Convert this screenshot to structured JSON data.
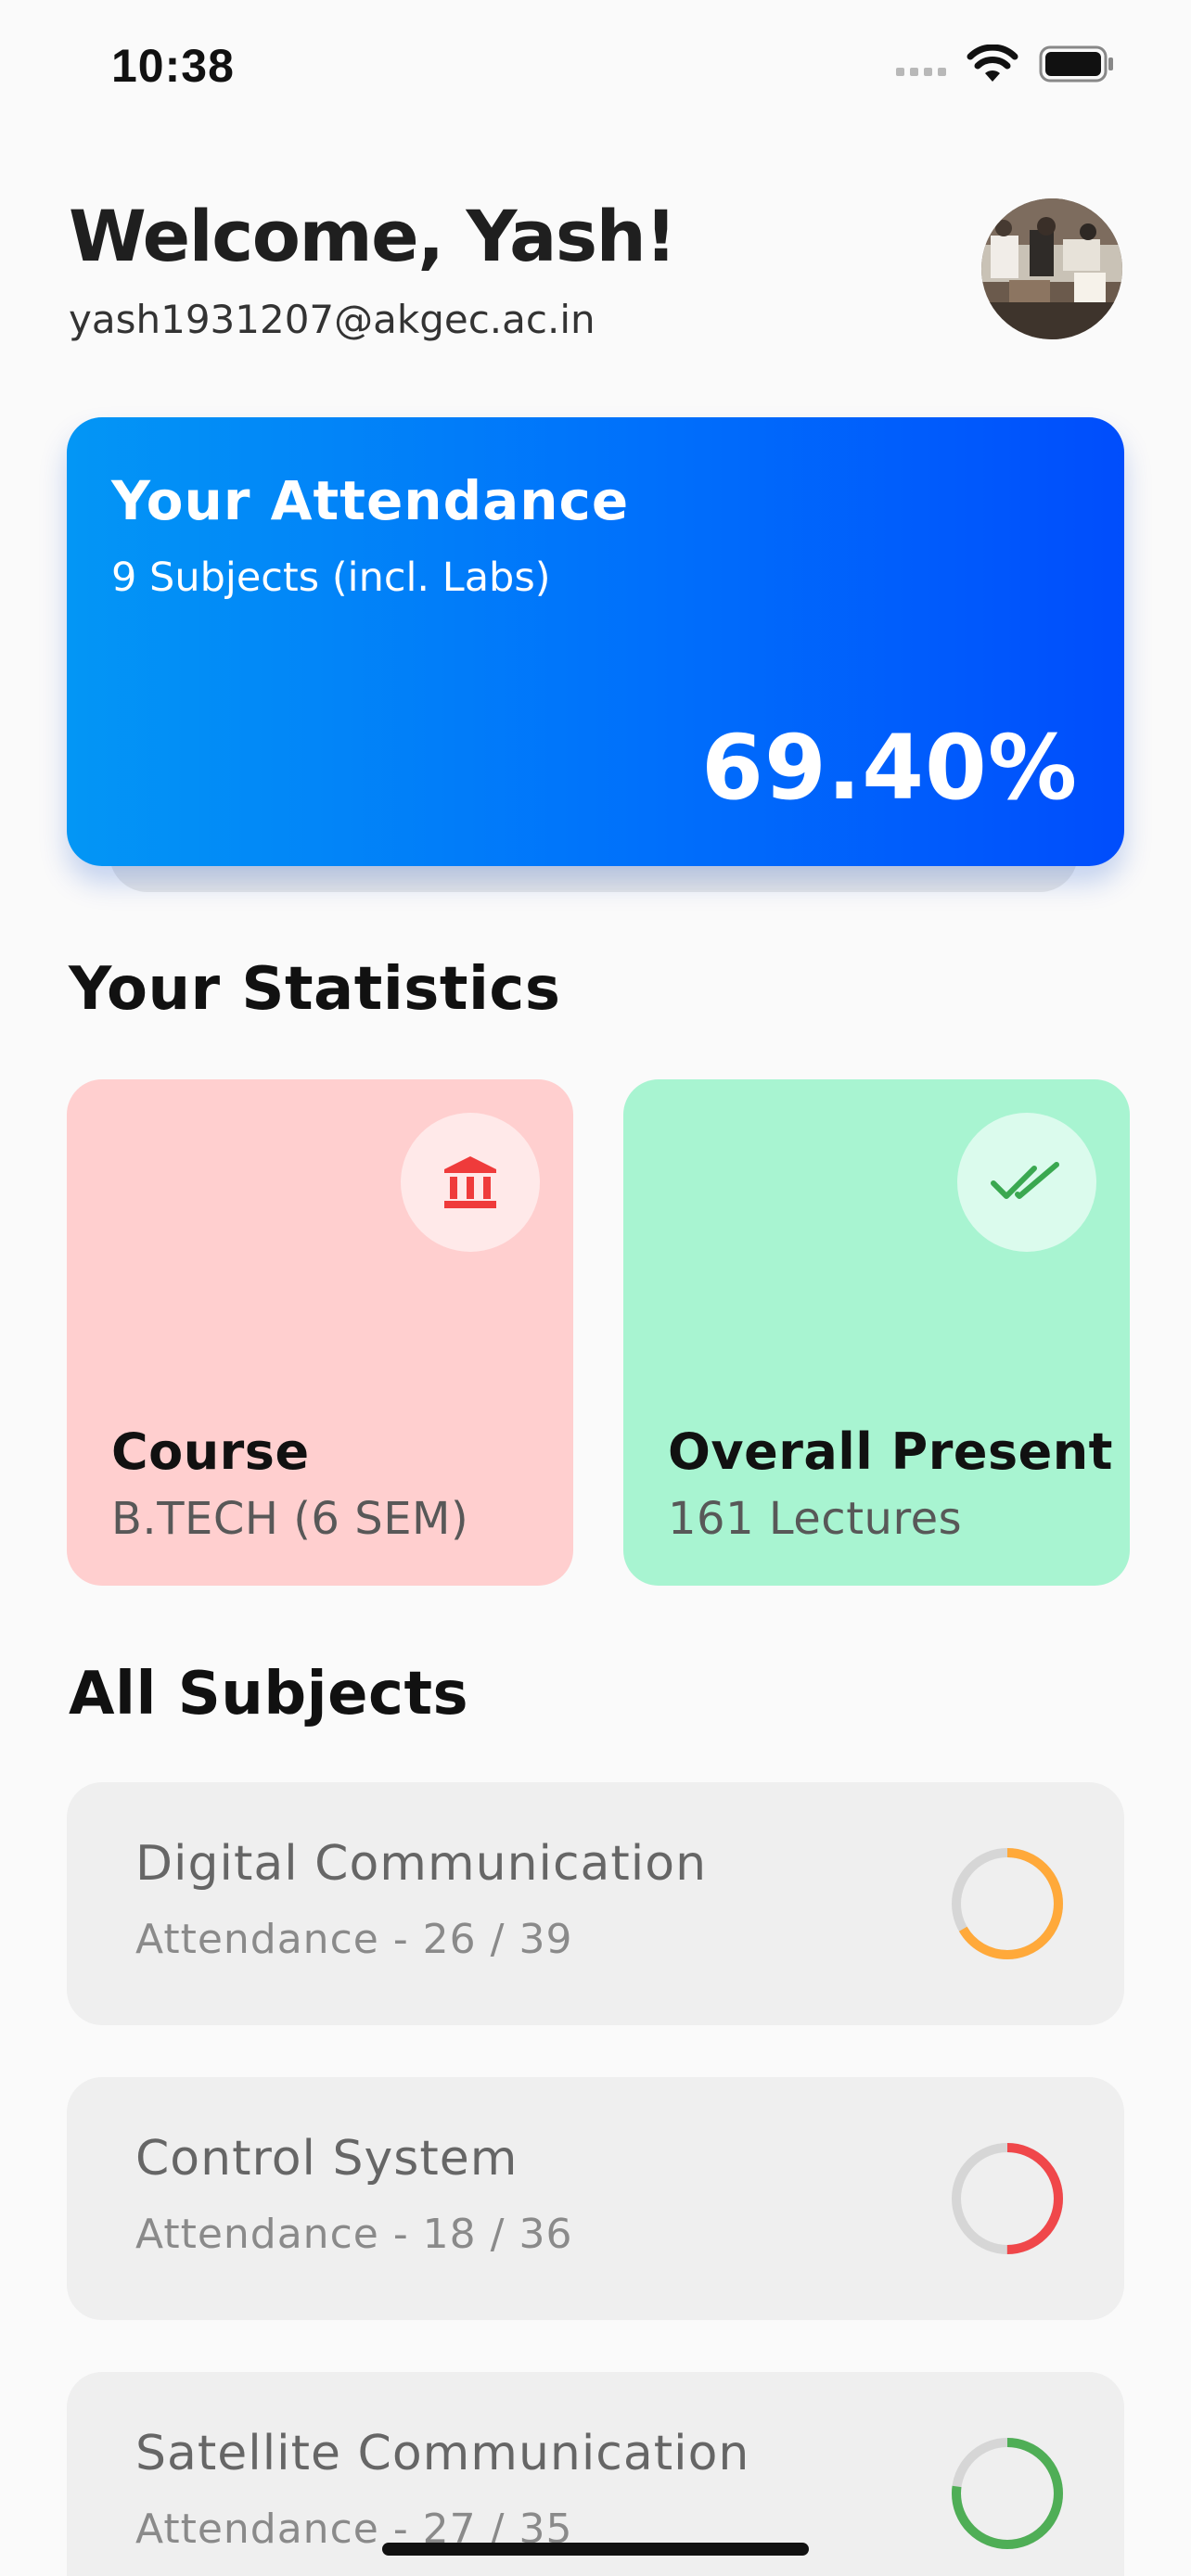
{
  "status_bar": {
    "time": "10:38"
  },
  "header": {
    "welcome": "Welcome, Yash!",
    "email": "yash1931207@akgec.ac.in"
  },
  "attendance_card": {
    "title": "Your Attendance",
    "subtitle": "9 Subjects (incl. Labs)",
    "percentage": "69.40%",
    "gradient_start": "#0396f5",
    "gradient_end": "#004dfc"
  },
  "statistics": {
    "title": "Your Statistics",
    "cards": [
      {
        "label": "Course",
        "value": "B.TECH (6 SEM)",
        "icon": "institution-icon",
        "background": "#ffcfcf",
        "icon_color": "#ef3b3b"
      },
      {
        "label": "Overall Present",
        "value": "161 Lectures",
        "icon": "double-check-icon",
        "background": "#a8f4d1",
        "icon_color": "#3aa850"
      }
    ]
  },
  "subjects": {
    "title": "All Subjects",
    "items": [
      {
        "name": "Digital Communication",
        "attendance": "Attendance - 26 / 39",
        "present": 26,
        "total": 39,
        "ring_color": "#ffa93a"
      },
      {
        "name": "Control System",
        "attendance": "Attendance - 18 / 36",
        "present": 18,
        "total": 36,
        "ring_color": "#f0474a"
      },
      {
        "name": "Satellite Communication",
        "attendance": "Attendance - 27 / 35",
        "present": 27,
        "total": 35,
        "ring_color": "#4fae56"
      }
    ]
  }
}
